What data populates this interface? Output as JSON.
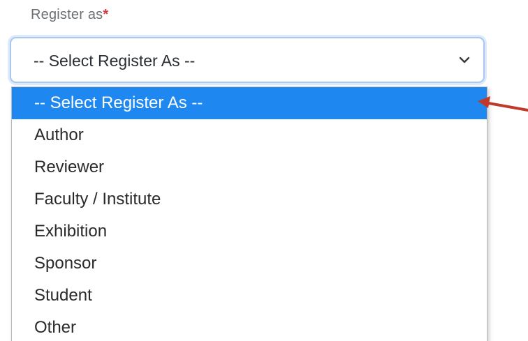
{
  "form": {
    "label": "Register as",
    "required_marker": "*",
    "select": {
      "current_value": "-- Select Register As --",
      "icon": "chevron-down-icon",
      "options": [
        "-- Select Register As --",
        "Author",
        "Reviewer",
        "Faculty / Institute",
        "Exhibition",
        "Sponsor",
        "Student",
        "Other"
      ],
      "highlighted_option": "-- Select Register As --"
    }
  },
  "annotation": {
    "icon": "red-arrow-icon",
    "color": "#c0392b"
  },
  "colors": {
    "highlight": "#1e88f0",
    "required": "#d9363e",
    "focus_border": "#a8c8f0"
  }
}
